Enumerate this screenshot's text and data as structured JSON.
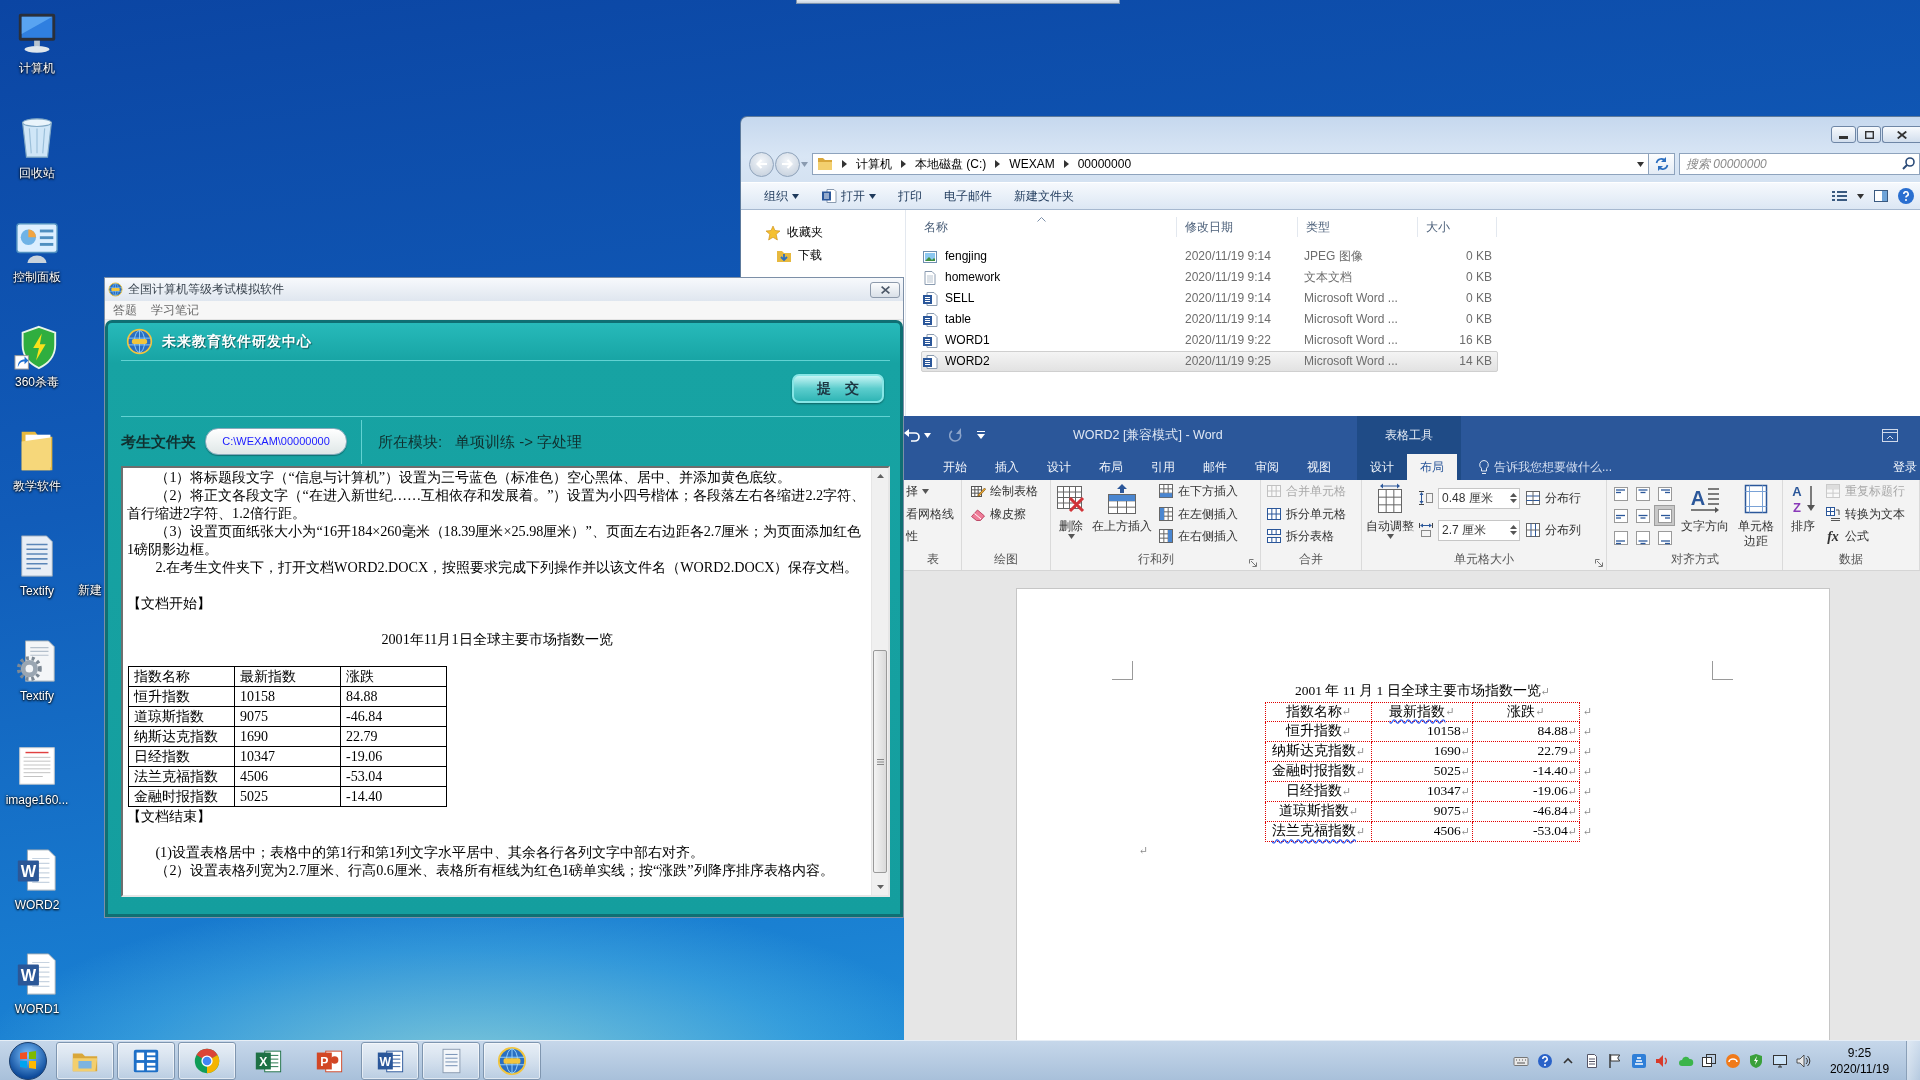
{
  "desktop": {
    "icons": [
      {
        "label": "计算机",
        "kind": "computer",
        "shortcut": false
      },
      {
        "label": "回收站",
        "kind": "recycle-bin",
        "shortcut": false
      },
      {
        "label": "控制面板",
        "kind": "control-panel",
        "shortcut": false
      },
      {
        "label": "360杀毒",
        "kind": "shield",
        "shortcut": true
      },
      {
        "label": "教学软件",
        "kind": "folder",
        "shortcut": false
      },
      {
        "label": "Textify",
        "kind": "text-file",
        "shortcut": false
      },
      {
        "label": "Textify",
        "kind": "gear-file",
        "shortcut": false
      },
      {
        "label": "image160...",
        "kind": "image-file",
        "shortcut": false
      },
      {
        "label": "WORD2",
        "kind": "word-file",
        "glyph": "W",
        "shortcut": false
      },
      {
        "label": "WORD1",
        "kind": "word-file",
        "glyph": "W",
        "shortcut": false
      }
    ],
    "partial_label": "新建"
  },
  "explorer": {
    "path": [
      "计算机",
      "本地磁盘 (C:)",
      "WEXAM",
      "00000000"
    ],
    "search_placeholder": "搜索 00000000",
    "toolbar": [
      {
        "label": "组织",
        "kind": "text",
        "dropdown": true
      },
      {
        "label": "打开",
        "kind": "app",
        "dropdown": true
      },
      {
        "label": "打印",
        "kind": "text",
        "dropdown": false
      },
      {
        "label": "电子邮件",
        "kind": "text",
        "dropdown": false
      },
      {
        "label": "新建文件夹",
        "kind": "text",
        "dropdown": false
      }
    ],
    "nav": [
      {
        "label": "收藏夹",
        "kind": "star"
      },
      {
        "label": "下载",
        "kind": "download"
      }
    ],
    "columns": [
      {
        "label": "名称",
        "sorted": true
      },
      {
        "label": "修改日期",
        "sorted": false
      },
      {
        "label": "类型",
        "sorted": false
      },
      {
        "label": "大小",
        "sorted": false
      }
    ],
    "files": [
      {
        "name": "fengjing",
        "date": "2020/11/19 9:14",
        "type": "JPEG 图像",
        "size": "0 KB",
        "kind": "image",
        "selected": false
      },
      {
        "name": "homework",
        "date": "2020/11/19 9:14",
        "type": "文本文档",
        "size": "0 KB",
        "kind": "text",
        "selected": false
      },
      {
        "name": "SELL",
        "date": "2020/11/19 9:14",
        "type": "Microsoft Word ...",
        "size": "0 KB",
        "kind": "word",
        "selected": false
      },
      {
        "name": "table",
        "date": "2020/11/19 9:14",
        "type": "Microsoft Word ...",
        "size": "0 KB",
        "kind": "word",
        "selected": false
      },
      {
        "name": "WORD1",
        "date": "2020/11/19 9:22",
        "type": "Microsoft Word ...",
        "size": "16 KB",
        "kind": "word",
        "selected": false
      },
      {
        "name": "WORD2",
        "date": "2020/11/19 9:25",
        "type": "Microsoft Word ...",
        "size": "14 KB",
        "kind": "word",
        "selected": true
      }
    ]
  },
  "exam": {
    "title": "全国计算机等级考试模拟软件",
    "menu": [
      "答题",
      "学习笔记"
    ],
    "brand": "未来教育软件研发中心",
    "submit": "提　交",
    "folder_label": "考生文件夹",
    "folder_path": "C:\\WEXAM\\00000000",
    "module_label": "所在模块:",
    "module": "单项训练 -> 字处理",
    "content": [
      {
        "kind": "para",
        "text": "（1）将标题段文字（“信息与计算机”）设置为三号蓝色（标准色）空心黑体、居中、并添加黄色底纹。"
      },
      {
        "kind": "para",
        "text": "（2）将正文各段文字（“在进入新世纪……互相依存和发展着。”）设置为小四号楷体；各段落左右各缩进2.2字符、首行缩进2字符、1.2倍行距。"
      },
      {
        "kind": "para",
        "text": "（3）设置页面纸张大小为“16开184×260毫米（18.39厘米×25.98厘米）”、页面左右边距各2.7厘米；为页面添加红色1磅阴影边框。"
      },
      {
        "kind": "para",
        "text": "2.在考生文件夹下，打开文档WORD2.DOCX，按照要求完成下列操作并以该文件名（WORD2.DOCX）保存文档。"
      },
      {
        "kind": "doc-start",
        "text": "【文档开始】"
      },
      {
        "kind": "title",
        "text": "2001年11月1日全球主要市场指数一览"
      },
      {
        "kind": "table",
        "rows": [
          [
            "指数名称",
            "最新指数",
            "涨跌"
          ],
          [
            "恒升指数",
            "10158",
            "84.88"
          ],
          [
            "道琼斯指数",
            "9075",
            "-46.84"
          ],
          [
            "纳斯达克指数",
            "1690",
            "22.79"
          ],
          [
            "日经指数",
            "10347",
            "-19.06"
          ],
          [
            "法兰克福指数",
            "4506",
            "-53.04"
          ],
          [
            "金融时报指数",
            "5025",
            "-14.40"
          ]
        ]
      },
      {
        "kind": "doc-end",
        "text": "【文档结束】"
      },
      {
        "kind": "para",
        "text": "(1)设置表格居中；表格中的第1行和第1列文字水平居中、其余各行各列文字中部右对齐。"
      },
      {
        "kind": "para",
        "text": "（2）设置表格列宽为2.7厘米、行高0.6厘米、表格所有框线为红色1磅单实线；按“涨跌”列降序排序表格内容。"
      }
    ]
  },
  "word": {
    "title": "WORD2 [兼容模式] - Word",
    "tabs": [
      {
        "label": "开始",
        "selected": false
      },
      {
        "label": "插入",
        "selected": false
      },
      {
        "label": "设计",
        "selected": false
      },
      {
        "label": "布局",
        "selected": false
      },
      {
        "label": "引用",
        "selected": false
      },
      {
        "label": "邮件",
        "selected": false
      },
      {
        "label": "审阅",
        "selected": false
      },
      {
        "label": "视图",
        "selected": false
      }
    ],
    "context": {
      "label": "表格工具",
      "tabs": [
        {
          "label": "设计",
          "selected": false
        },
        {
          "label": "布局",
          "selected": true
        }
      ]
    },
    "tell_me": "告诉我您想要做什么...",
    "sign_in": "登录",
    "groups": [
      {
        "label": "表",
        "launcher": false,
        "items": [
          {
            "kind": "small",
            "label": "择",
            "dropdown": true,
            "disabled": false
          },
          {
            "kind": "small",
            "label": "看网格线",
            "dropdown": false,
            "disabled": false
          },
          {
            "kind": "small",
            "label": "性",
            "dropdown": false,
            "disabled": false
          }
        ]
      },
      {
        "label": "绘图",
        "launcher": false,
        "items": [
          {
            "kind": "small",
            "label": "绘制表格",
            "dropdown": false,
            "disabled": false
          },
          {
            "kind": "small",
            "label": "橡皮擦",
            "dropdown": false,
            "disabled": false
          }
        ]
      },
      {
        "label": "行和列",
        "launcher": true,
        "items": [
          {
            "kind": "large",
            "label": "删除",
            "dropdown": true,
            "disabled": false
          },
          {
            "kind": "large",
            "label": "在上方插入",
            "dropdown": false,
            "disabled": false
          },
          {
            "kind": "small",
            "label": "在下方插入",
            "dropdown": false,
            "disabled": false
          },
          {
            "kind": "small",
            "label": "在左侧插入",
            "dropdown": false,
            "disabled": false
          },
          {
            "kind": "small",
            "label": "在右侧插入",
            "dropdown": false,
            "disabled": false
          }
        ]
      },
      {
        "label": "合并",
        "launcher": false,
        "items": [
          {
            "kind": "small",
            "label": "合并单元格",
            "dropdown": false,
            "disabled": true
          },
          {
            "kind": "small",
            "label": "拆分单元格",
            "dropdown": false,
            "disabled": false
          },
          {
            "kind": "small",
            "label": "拆分表格",
            "dropdown": false,
            "disabled": false
          }
        ]
      },
      {
        "label": "单元格大小",
        "launcher": true,
        "items": [
          {
            "kind": "large",
            "label": "自动调整",
            "dropdown": true,
            "disabled": false
          },
          {
            "kind": "field",
            "value": "0.48 厘米",
            "disabled": false
          },
          {
            "kind": "field",
            "value": "2.7 厘米",
            "disabled": false
          },
          {
            "kind": "small",
            "label": "分布行",
            "dropdown": false,
            "disabled": false
          },
          {
            "kind": "small",
            "label": "分布列",
            "dropdown": false,
            "disabled": false
          }
        ]
      },
      {
        "label": "对齐方式",
        "launcher": false,
        "align_cells": [
          {
            "selected": false
          },
          {
            "selected": false
          },
          {
            "selected": false
          },
          {
            "selected": false
          },
          {
            "selected": false
          },
          {
            "selected": true
          },
          {
            "selected": false
          },
          {
            "selected": false
          },
          {
            "selected": false
          }
        ],
        "items": [
          {
            "kind": "large",
            "label": "文字方向",
            "glyphs": [
              "A"
            ],
            "dropdown": false,
            "disabled": false
          },
          {
            "kind": "large",
            "label": "单元格边距",
            "dropdown": false,
            "disabled": false
          }
        ]
      },
      {
        "label": "数据",
        "launcher": false,
        "items": [
          {
            "kind": "large",
            "label": "排序",
            "glyphs": [
              "A",
              "Z"
            ],
            "dropdown": false,
            "disabled": false
          },
          {
            "kind": "small",
            "label": "重复标题行",
            "dropdown": false,
            "disabled": true
          },
          {
            "kind": "small",
            "label": "转换为文本",
            "dropdown": false,
            "disabled": false
          },
          {
            "kind": "small",
            "label": "公式",
            "glyphs": [
              "fx"
            ],
            "dropdown": false,
            "disabled": false
          }
        ]
      }
    ],
    "document": {
      "title": "2001 年 11 月 1 日全球主要市场指数一览",
      "title_mark": "↵",
      "rows": [
        {
          "cells": [
            {
              "text": "指数名称",
              "mark": "↵",
              "flagged": false
            },
            {
              "text": "最新指数",
              "mark": "↵",
              "flagged": true
            },
            {
              "text": "涨跌",
              "mark": "↵",
              "flagged": false
            }
          ],
          "end_mark": "↵"
        },
        {
          "cells": [
            {
              "text": "恒升指数",
              "mark": "↵",
              "flagged": false
            },
            {
              "text": "10158",
              "mark": "↵",
              "flagged": false
            },
            {
              "text": "84.88",
              "mark": "↵",
              "flagged": false
            }
          ],
          "end_mark": "↵"
        },
        {
          "cells": [
            {
              "text": "纳斯达克指数",
              "mark": "↵",
              "flagged": false
            },
            {
              "text": "1690",
              "mark": "↵",
              "flagged": false
            },
            {
              "text": "22.79",
              "mark": "↵",
              "flagged": false
            }
          ],
          "end_mark": "↵"
        },
        {
          "cells": [
            {
              "text": "金融时报指数",
              "mark": "↵",
              "flagged": false
            },
            {
              "text": "5025",
              "mark": "↵",
              "flagged": false
            },
            {
              "text": "-14.40",
              "mark": "↵",
              "flagged": false
            }
          ],
          "end_mark": "↵"
        },
        {
          "cells": [
            {
              "text": "日经指数",
              "mark": "↵",
              "flagged": false
            },
            {
              "text": "10347",
              "mark": "↵",
              "flagged": false
            },
            {
              "text": "-19.06",
              "mark": "↵",
              "flagged": false
            }
          ],
          "end_mark": "↵"
        },
        {
          "cells": [
            {
              "text": "道琼斯指数",
              "mark": "↵",
              "flagged": false
            },
            {
              "text": "9075",
              "mark": "↵",
              "flagged": false
            },
            {
              "text": "-46.84",
              "mark": "↵",
              "flagged": false
            }
          ],
          "end_mark": "↵"
        },
        {
          "cells": [
            {
              "text": "法兰克福指数",
              "mark": "↵",
              "flagged": true
            },
            {
              "text": "4506",
              "mark": "↵",
              "flagged": false
            },
            {
              "text": "-53.04",
              "mark": "↵",
              "flagged": false
            }
          ],
          "end_mark": "↵"
        }
      ],
      "trailing_mark": "↵"
    }
  },
  "taskbar": {
    "apps": [
      {
        "kind": "explorer",
        "running": true
      },
      {
        "kind": "tiles",
        "running": true
      },
      {
        "kind": "browser",
        "running": true
      },
      {
        "kind": "spreadsheet",
        "glyph": "X",
        "running": false
      },
      {
        "kind": "slides",
        "glyph": "P",
        "running": false
      },
      {
        "kind": "word",
        "glyph": "W",
        "running": true
      },
      {
        "kind": "notepad",
        "running": true
      },
      {
        "kind": "exam",
        "running": true
      }
    ],
    "clock": {
      "time": "9:25",
      "date": "2020/11/19"
    }
  }
}
